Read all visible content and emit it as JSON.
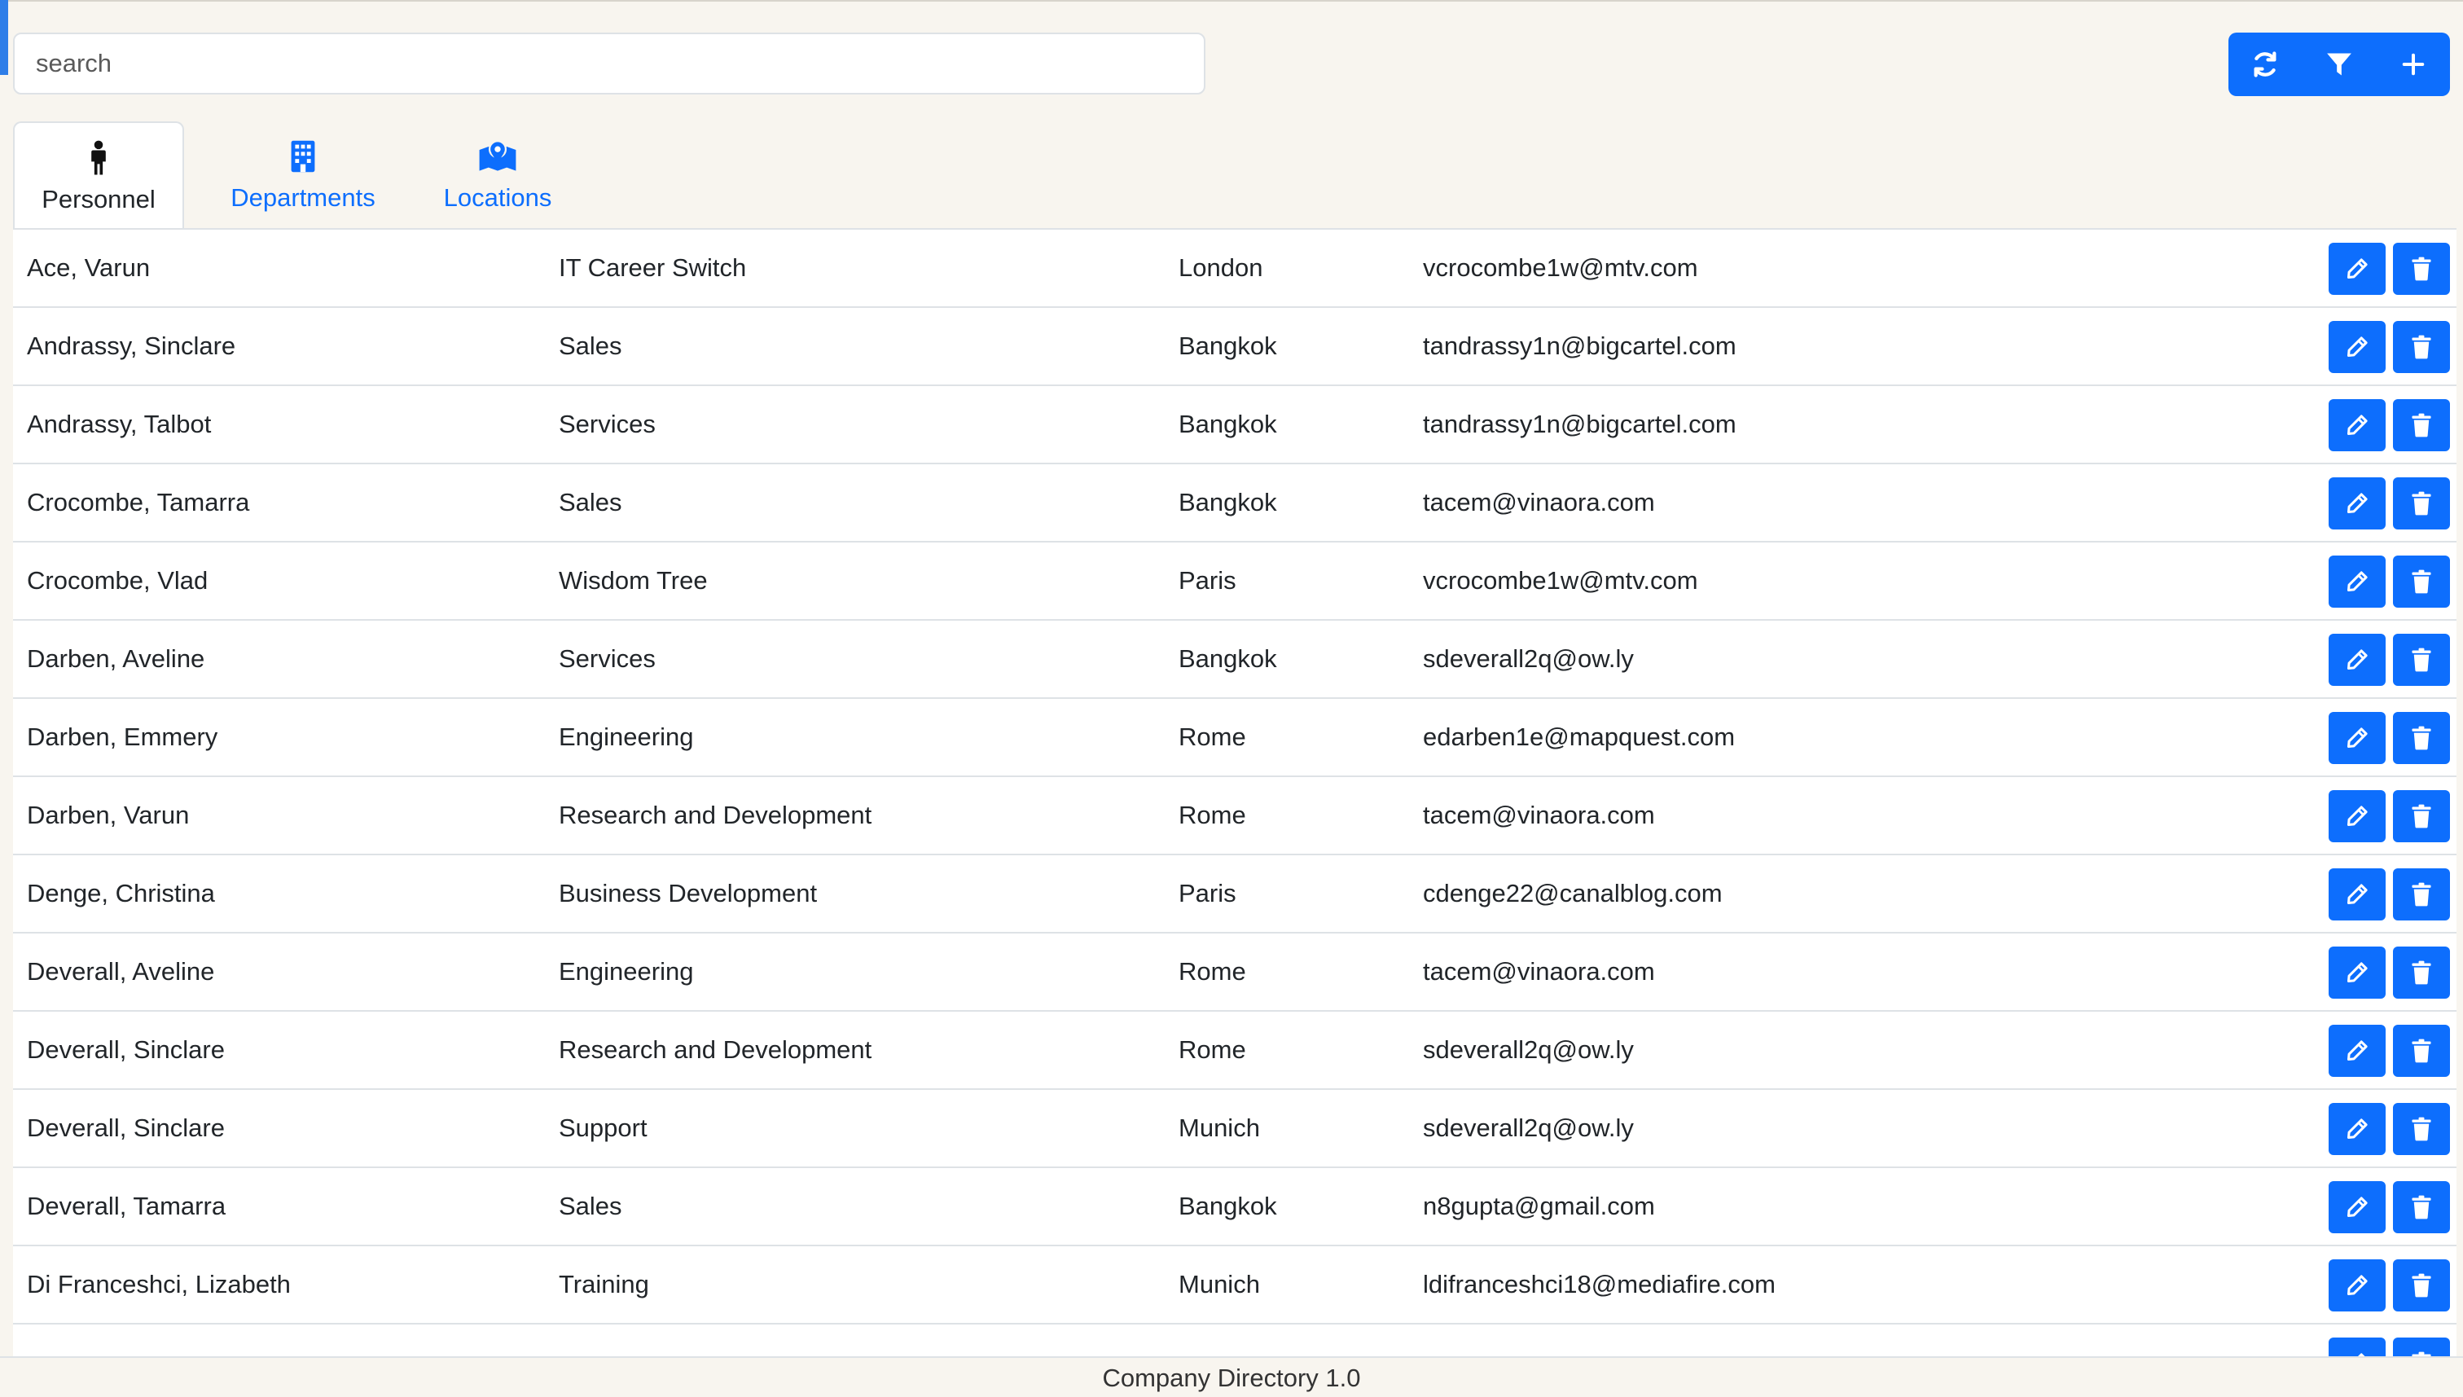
{
  "search": {
    "placeholder": "search",
    "value": ""
  },
  "toolbar": {
    "refresh_icon": "refresh-icon",
    "filter_icon": "filter-icon",
    "add_icon": "plus-icon"
  },
  "tabs": [
    {
      "label": "Personnel",
      "icon": "person-icon",
      "active": true
    },
    {
      "label": "Departments",
      "icon": "building-icon",
      "active": false
    },
    {
      "label": "Locations",
      "icon": "map-location-icon",
      "active": false
    }
  ],
  "table": {
    "rows": [
      {
        "name": "Ace, Varun",
        "department": "IT Career Switch",
        "location": "London",
        "email": "vcrocombe1w@mtv.com"
      },
      {
        "name": "Andrassy, Sinclare",
        "department": "Sales",
        "location": "Bangkok",
        "email": "tandrassy1n@bigcartel.com"
      },
      {
        "name": "Andrassy, Talbot",
        "department": "Services",
        "location": "Bangkok",
        "email": "tandrassy1n@bigcartel.com"
      },
      {
        "name": "Crocombe, Tamarra",
        "department": "Sales",
        "location": "Bangkok",
        "email": "tacem@vinaora.com"
      },
      {
        "name": "Crocombe, Vlad",
        "department": "Wisdom Tree",
        "location": "Paris",
        "email": "vcrocombe1w@mtv.com"
      },
      {
        "name": "Darben, Aveline",
        "department": "Services",
        "location": "Bangkok",
        "email": "sdeverall2q@ow.ly"
      },
      {
        "name": "Darben, Emmery",
        "department": "Engineering",
        "location": "Rome",
        "email": "edarben1e@mapquest.com"
      },
      {
        "name": "Darben, Varun",
        "department": "Research and Development",
        "location": "Rome",
        "email": "tacem@vinaora.com"
      },
      {
        "name": "Denge, Christina",
        "department": "Business Development",
        "location": "Paris",
        "email": "cdenge22@canalblog.com"
      },
      {
        "name": "Deverall, Aveline",
        "department": "Engineering",
        "location": "Rome",
        "email": "tacem@vinaora.com"
      },
      {
        "name": "Deverall, Sinclare",
        "department": "Research and Development",
        "location": "Rome",
        "email": "sdeverall2q@ow.ly"
      },
      {
        "name": "Deverall, Sinclare",
        "department": "Support",
        "location": "Munich",
        "email": "sdeverall2q@ow.ly"
      },
      {
        "name": "Deverall, Tamarra",
        "department": "Sales",
        "location": "Bangkok",
        "email": "n8gupta@gmail.com"
      },
      {
        "name": "Di Franceshci, Lizabeth",
        "department": "Training",
        "location": "Munich",
        "email": "ldifranceshci18@mediafire.com"
      },
      {
        "name": "",
        "department": "",
        "location": "",
        "email": ""
      }
    ],
    "edit_icon": "pencil-icon",
    "delete_icon": "trash-icon"
  },
  "footer": {
    "text": "Company Directory 1.0"
  },
  "colors": {
    "accent": "#0d6efd",
    "background": "#f8f5ef",
    "row_border": "#dee2e6"
  }
}
